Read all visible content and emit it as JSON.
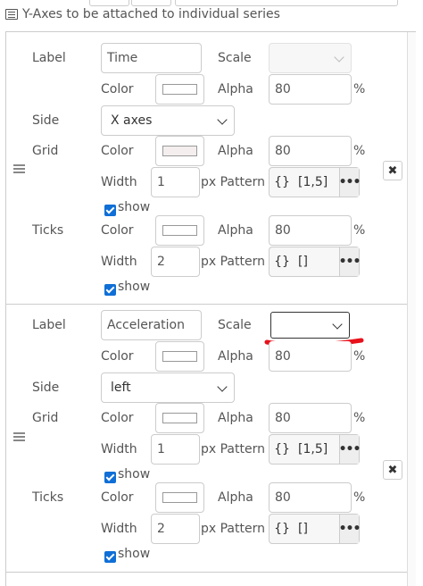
{
  "section_title": "Y-Axes to be attached to individual series",
  "labels": {
    "label": "Label",
    "scale": "Scale",
    "color": "Color",
    "alpha": "Alpha",
    "side": "Side",
    "grid": "Grid",
    "width": "Width",
    "px_pattern": "px Pattern",
    "ticks": "Ticks",
    "show": "show",
    "percent": "%",
    "braces": "{}",
    "dots": "•••",
    "delete": "✖"
  },
  "axes": [
    {
      "label_value": "Time",
      "scale_value": "",
      "color_alpha": "80",
      "side_value": "X axes",
      "grid": {
        "alpha": "80",
        "width": "1",
        "pattern": "[1,5]",
        "show": true
      },
      "ticks": {
        "alpha": "80",
        "width": "2",
        "pattern": "[]",
        "show": true
      }
    },
    {
      "label_value": "Acceleration",
      "scale_value": "",
      "color_alpha": "80",
      "side_value": "left",
      "grid": {
        "alpha": "80",
        "width": "1",
        "pattern": "[1,5]",
        "show": true
      },
      "ticks": {
        "alpha": "80",
        "width": "2",
        "pattern": "[]",
        "show": true
      }
    }
  ],
  "colors": {
    "accent_check": "#0f6fd6",
    "annotation_red": "#e8101a"
  }
}
